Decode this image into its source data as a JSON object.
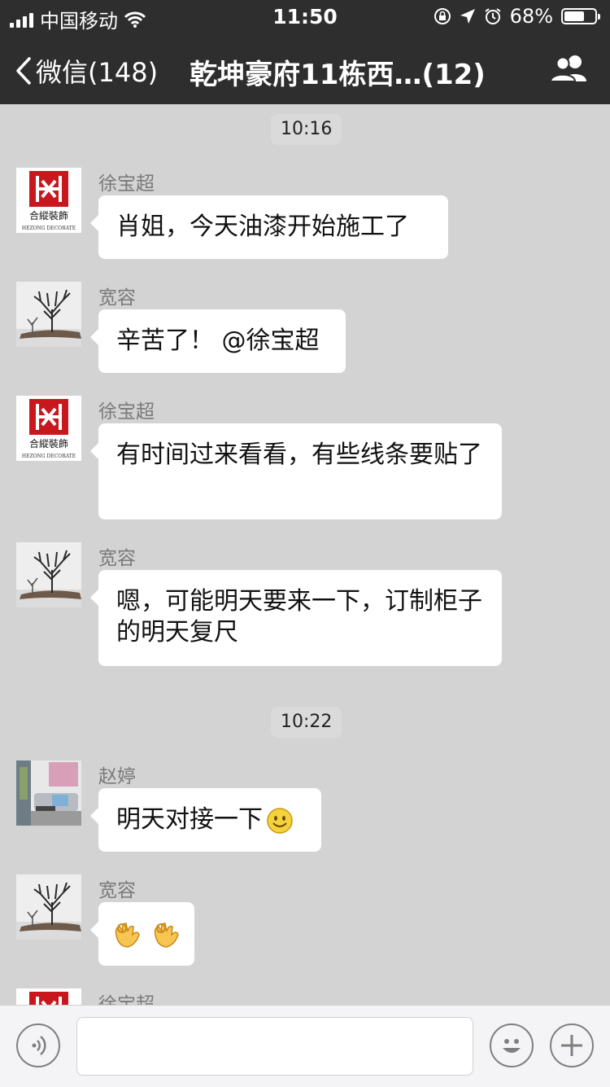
{
  "status_bar": {
    "carrier": "中国移动",
    "time": "11:50",
    "battery": "68%",
    "battery_level": 0.68
  },
  "nav": {
    "back_label": "微信(148)",
    "title": "乾坤豪府11栋西…(12)"
  },
  "chat": {
    "timestamps": [
      "10:16",
      "10:22"
    ],
    "messages": [
      {
        "sender": "徐宝超",
        "text": "肖姐，今天油漆开始施工了"
      },
      {
        "sender": "宽容",
        "text": "辛苦了！ @徐宝超"
      },
      {
        "sender": "徐宝超",
        "text": "有时间过来看看，有些线条要贴了"
      },
      {
        "sender": "宽容",
        "text": "嗯，可能明天要来一下，订制柜子的明天复尺"
      },
      {
        "sender": "赵婷",
        "text": "明天对接一下"
      },
      {
        "sender": "宽容",
        "text": ""
      },
      {
        "sender": "徐宝超",
        "text": ""
      }
    ],
    "logo_text": {
      "cn": "合縱裝飾",
      "en": "HEZONG DECORATE"
    }
  },
  "colors": {
    "nav_bg": "#2e2e2f",
    "chat_bg": "#d3d3d3",
    "logo_red": "#c8171d"
  }
}
